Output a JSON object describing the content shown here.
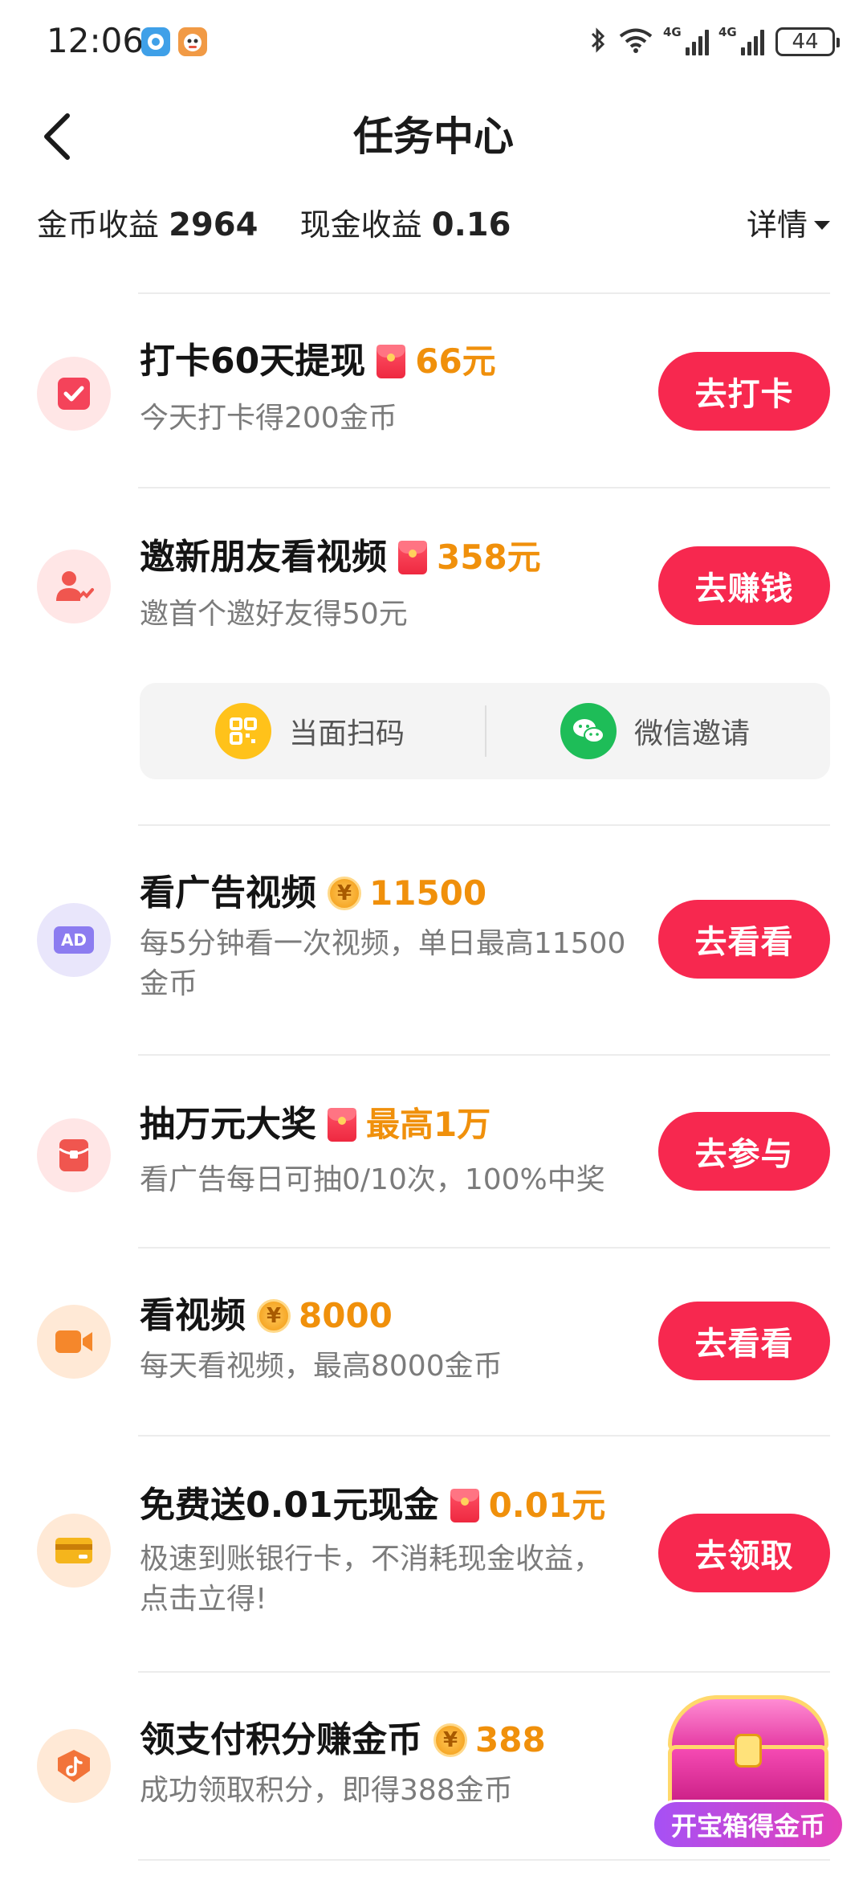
{
  "status_bar": {
    "time": "12:06",
    "signal_tag_1": "4G",
    "signal_tag_2": "4G",
    "battery": "44"
  },
  "header": {
    "title": "任务中心"
  },
  "summary": {
    "coin_label": "金币收益",
    "coin_value": "2964",
    "cash_label": "现金收益",
    "cash_value": "0.16",
    "details_label": "详情"
  },
  "tasks": [
    {
      "title": "打卡60天提现",
      "reward_type": "envelope",
      "reward": "66元",
      "sub": "今天打卡得200金币",
      "button": "去打卡",
      "icon": "checkin-icon"
    },
    {
      "title": "邀新朋友看视频",
      "reward_type": "envelope",
      "reward": "358元",
      "sub": "邀首个邀好友得50元",
      "button": "去赚钱",
      "icon": "invite-friends-icon"
    },
    {
      "title": "看广告视频",
      "reward_type": "coin",
      "reward": "11500",
      "sub_line1": "每5分钟看一次视频，单日最高11500",
      "sub_line2": "金币",
      "button": "去看看",
      "icon": "ad-icon",
      "icon_text": "AD"
    },
    {
      "title": "抽万元大奖",
      "reward_type": "envelope",
      "reward": "最高1万",
      "sub": "看广告每日可抽0/10次，100%中奖",
      "button": "去参与",
      "icon": "lottery-icon"
    },
    {
      "title": "看视频",
      "reward_type": "coin",
      "reward": "8000",
      "sub": "每天看视频，最高8000金币",
      "button": "去看看",
      "icon": "video-camera-icon"
    },
    {
      "title": "免费送0.01元现金",
      "reward_type": "envelope",
      "reward": "0.01元",
      "sub_line1": "极速到账银行卡，不消耗现金收益，",
      "sub_line2": "点击立得!",
      "button": "去领取",
      "icon": "bank-card-icon"
    },
    {
      "title": "领支付积分赚金币",
      "reward_type": "coin",
      "reward": "388",
      "sub": "成功领取积分，即得388金币",
      "icon": "douyin-pay-icon"
    }
  ],
  "invite_options": {
    "scan": "当面扫码",
    "wechat": "微信邀请"
  },
  "coin_symbol": "¥",
  "treasure_label": "开宝箱得金币",
  "colors": {
    "button_red": "#f7284f",
    "reward_orange": "#f0900b"
  }
}
